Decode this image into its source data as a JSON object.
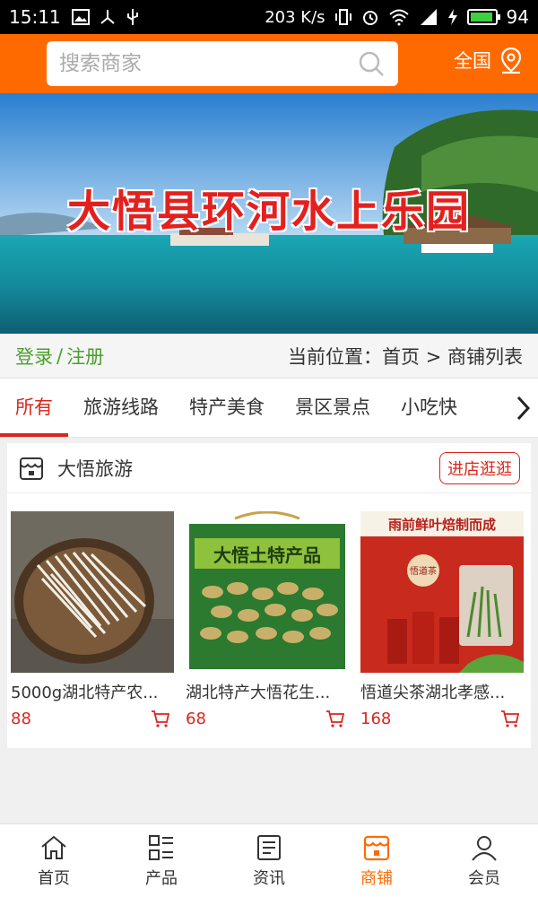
{
  "status_bar": {
    "time": "15:11",
    "speed": "203 K/s",
    "battery": "94",
    "battery_level": 0.94,
    "icons": [
      "image-icon",
      "usb-tree-icon",
      "usb-icon",
      "vibrate-icon",
      "alarm-icon",
      "wifi-icon",
      "signal-4g-icon",
      "charging-icon",
      "battery-icon"
    ]
  },
  "header": {
    "search_placeholder": "搜索商家",
    "region_label": "全国",
    "accent_color": "#ff6a00"
  },
  "banner": {
    "title": "大悟县环河水上乐园"
  },
  "location_row": {
    "login": "登录",
    "separator": "/",
    "register": "注册",
    "breadcrumb": "当前位置：首页 > 商铺列表"
  },
  "tabs": [
    {
      "label": "所有",
      "active": true
    },
    {
      "label": "旅游线路",
      "active": false
    },
    {
      "label": "特产美食",
      "active": false
    },
    {
      "label": "景区景点",
      "active": false
    },
    {
      "label": "小吃快",
      "active": false
    }
  ],
  "shop": {
    "name": "大悟旅游",
    "visit_label": "进店逛逛",
    "products": [
      {
        "name": "5000g湖北特产农...",
        "price": "88"
      },
      {
        "name": "湖北特产大悟花生...",
        "price": "68"
      },
      {
        "name": "悟道尖茶湖北孝感...",
        "price": "168"
      }
    ]
  },
  "product_images": {
    "p2_text": "大悟土特产品",
    "p3_top_text": "雨前鲜叶焙制而成",
    "p3_tag": "悟道茶"
  },
  "bottom_nav": [
    {
      "label": "首页",
      "icon": "home-icon",
      "active": false
    },
    {
      "label": "产品",
      "icon": "list-icon",
      "active": false
    },
    {
      "label": "资讯",
      "icon": "news-icon",
      "active": false
    },
    {
      "label": "商铺",
      "icon": "shop-icon",
      "active": true
    },
    {
      "label": "会员",
      "icon": "user-icon",
      "active": false
    }
  ],
  "colors": {
    "accent_orange": "#ff6a00",
    "price_red": "#d9261c",
    "login_green": "#4aa02c"
  }
}
